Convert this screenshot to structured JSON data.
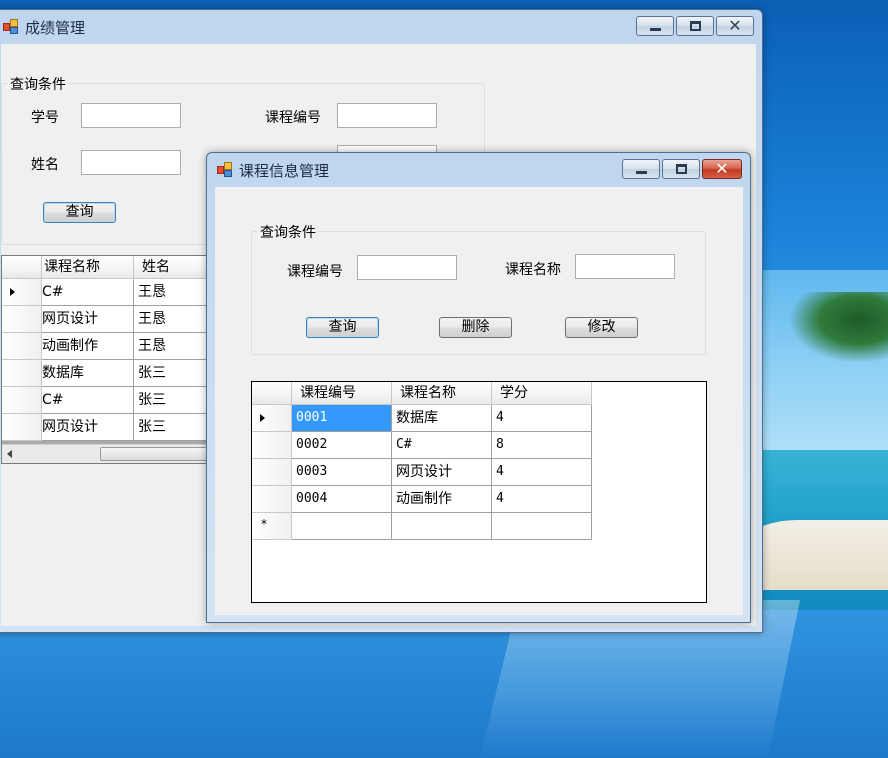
{
  "back_window": {
    "title": "成绩管理",
    "group_title": "查询条件",
    "student_no_label": "学号",
    "course_no_label": "课程编号",
    "name_label": "姓名",
    "query_button": "查询",
    "grid": {
      "columns": [
        "课程名称",
        "姓名"
      ],
      "rows": [
        [
          "C#",
          "王恳"
        ],
        [
          "网页设计",
          "王恳"
        ],
        [
          "动画制作",
          "王恳"
        ],
        [
          "数据库",
          "张三"
        ],
        [
          "C#",
          "张三"
        ],
        [
          "网页设计",
          "张三"
        ]
      ]
    }
  },
  "front_window": {
    "title": "课程信息管理",
    "group_title": "查询条件",
    "course_no_label": "课程编号",
    "course_name_label": "课程名称",
    "query_button": "查询",
    "delete_button": "删除",
    "modify_button": "修改",
    "grid": {
      "columns": [
        "课程编号",
        "课程名称",
        "学分"
      ],
      "rows": [
        [
          "0001",
          "数据库",
          "4"
        ],
        [
          "0002",
          "C#",
          "8"
        ],
        [
          "0003",
          "网页设计",
          "4"
        ],
        [
          "0004",
          "动画制作",
          "4"
        ]
      ],
      "new_row_marker": "*"
    }
  },
  "caption": {
    "close_glyph": "✕"
  }
}
